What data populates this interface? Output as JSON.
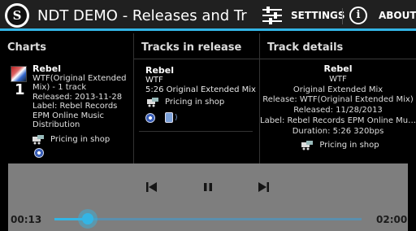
{
  "actionbar": {
    "app_icon_letter": "S",
    "title": "NDT DEMO - Releases and Trac…",
    "settings_label": "SETTINGS",
    "about_label": "ABOUT",
    "accent": "#33b5e5"
  },
  "charts": {
    "heading": "Charts",
    "entry": {
      "rank": "1",
      "artist": "Rebel",
      "title": "WTF(Original Extended Mix) - 1 track",
      "released": "Released: 2013-11-28",
      "label": "Label: Rebel Records EPM Online Music Distribution",
      "shop": "Pricing in shop"
    }
  },
  "release": {
    "heading": "Tracks in release",
    "entry": {
      "artist": "Rebel",
      "title": "WTF",
      "track": "5:26 Original Extended Mix",
      "shop": "Pricing in shop"
    }
  },
  "details": {
    "heading": "Track details",
    "artist": "Rebel",
    "title": "WTF",
    "mix": "Original Extended Mix",
    "release": "Release: WTF(Original Extended Mix)",
    "released": "Released: 11/28/2013",
    "label": "Label: Rebel Records EPM Online Mu…",
    "duration": "Duration: 5:26 320bps",
    "shop": "Pricing in shop"
  },
  "player": {
    "elapsed": "00:13",
    "total": "02:00",
    "progress": 0.108
  }
}
